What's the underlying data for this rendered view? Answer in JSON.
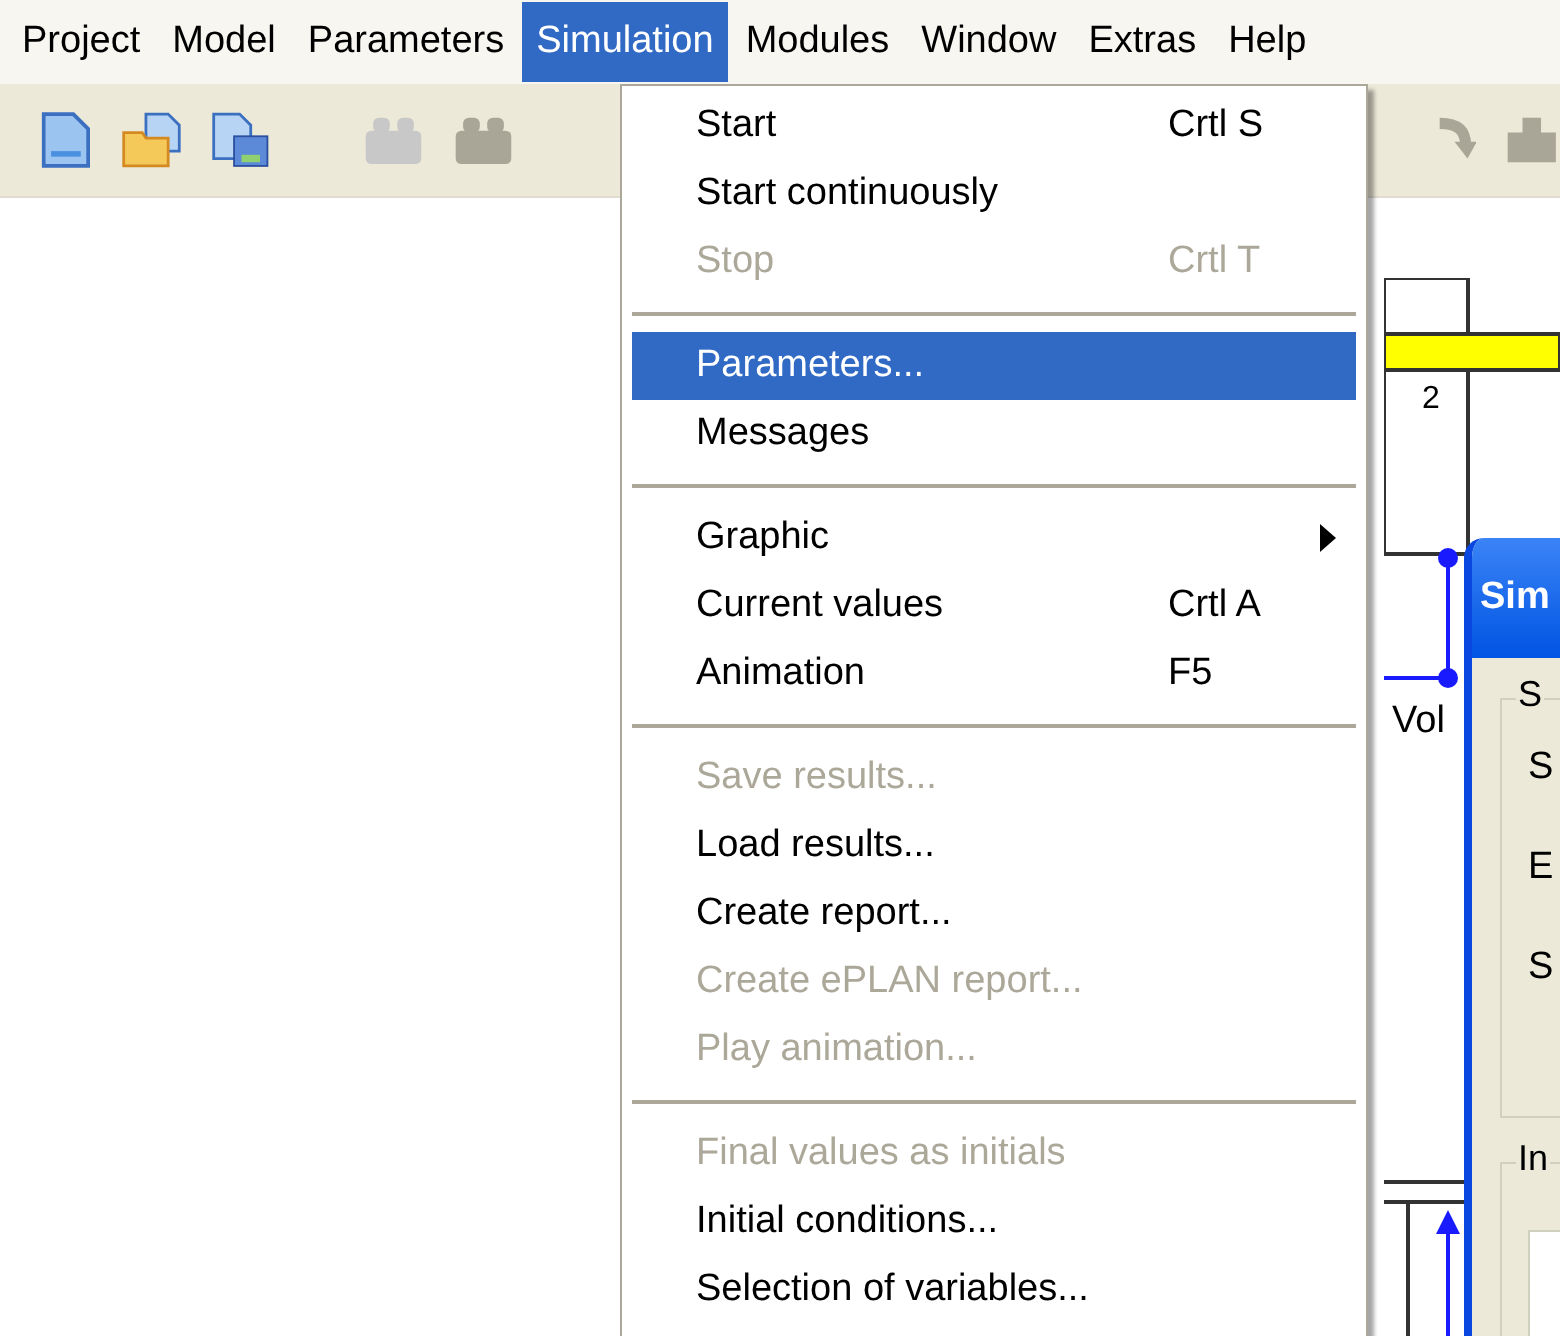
{
  "menu_bar": [
    {
      "label": "Project",
      "selected": false
    },
    {
      "label": "Model",
      "selected": false
    },
    {
      "label": "Parameters",
      "selected": false
    },
    {
      "label": "Simulation",
      "selected": true
    },
    {
      "label": "Modules",
      "selected": false
    },
    {
      "label": "Window",
      "selected": false
    },
    {
      "label": "Extras",
      "selected": false
    },
    {
      "label": "Help",
      "selected": false
    }
  ],
  "menu": [
    {
      "kind": "item",
      "label": "Start",
      "shortcut": "Crtl S",
      "disabled": false,
      "selected": false
    },
    {
      "kind": "item",
      "label": "Start continuously",
      "disabled": false,
      "selected": false
    },
    {
      "kind": "item",
      "label": "Stop",
      "shortcut": "Crtl T",
      "disabled": true,
      "selected": false
    },
    {
      "kind": "separator"
    },
    {
      "kind": "item",
      "label": "Parameters...",
      "disabled": false,
      "selected": true
    },
    {
      "kind": "item",
      "label": "Messages",
      "disabled": false,
      "selected": false
    },
    {
      "kind": "separator"
    },
    {
      "kind": "item",
      "label": "Graphic",
      "disabled": false,
      "selected": false,
      "submenu": true
    },
    {
      "kind": "item",
      "label": "Current values",
      "shortcut": "Crtl A",
      "disabled": false,
      "selected": false
    },
    {
      "kind": "item",
      "label": "Animation",
      "shortcut": "F5",
      "disabled": false,
      "selected": false
    },
    {
      "kind": "separator"
    },
    {
      "kind": "item",
      "label": "Save results...",
      "disabled": true,
      "selected": false
    },
    {
      "kind": "item",
      "label": "Load results...",
      "disabled": false,
      "selected": false
    },
    {
      "kind": "item",
      "label": "Create report...",
      "disabled": false,
      "selected": false
    },
    {
      "kind": "item",
      "label": "Create ePLAN report...",
      "disabled": true,
      "selected": false
    },
    {
      "kind": "item",
      "label": "Play animation...",
      "disabled": true,
      "selected": false
    },
    {
      "kind": "separator"
    },
    {
      "kind": "item",
      "label": "Final values as initials",
      "disabled": true,
      "selected": false
    },
    {
      "kind": "item",
      "label": "Initial conditions...",
      "disabled": false,
      "selected": false
    },
    {
      "kind": "item",
      "label": "Selection of variables...",
      "disabled": false,
      "selected": false
    }
  ],
  "diagram": {
    "port_label": "2",
    "signal_label": "Vol"
  },
  "dialog": {
    "title": "Sim",
    "group_1": {
      "label": "S",
      "rows": [
        "S",
        "E",
        "S"
      ]
    },
    "group_2": {
      "label": "In"
    }
  }
}
